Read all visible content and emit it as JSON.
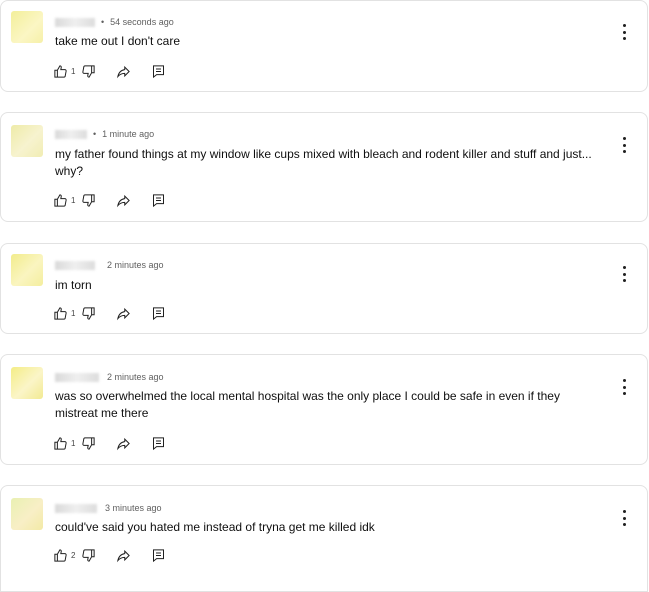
{
  "comments": [
    {
      "time": "54 seconds ago",
      "text": "take me out I don't care",
      "likes": "1",
      "avatar_colors": [
        "#f3ef9a",
        "#fbf6c4"
      ]
    },
    {
      "time": "1 minute ago",
      "text": "my father found things at my window like cups mixed with bleach and rodent killer and stuff and just... why?",
      "likes": "1",
      "avatar_colors": [
        "#eeeba8",
        "#f7f3cf"
      ]
    },
    {
      "time": "2 minutes ago",
      "text": "im torn",
      "likes": "1",
      "avatar_colors": [
        "#f2ec8c",
        "#faf5c0"
      ]
    },
    {
      "time": "2 minutes ago",
      "text": "was so overwhelmed the local mental hospital was the only place I could be safe in even if they mistreat me there",
      "likes": "1",
      "avatar_colors": [
        "#f4ed86",
        "#fbf5c8"
      ]
    },
    {
      "time": "3 minutes ago",
      "text": "could've said you hated me instead of tryna get me killed idk",
      "likes": "2",
      "avatar_colors": [
        "#e9f0b2",
        "#f8efc6"
      ]
    }
  ],
  "separator": "•",
  "icons": [
    "thumbs-up-icon",
    "thumbs-down-icon",
    "share-icon",
    "report-icon",
    "more-vert-icon"
  ]
}
